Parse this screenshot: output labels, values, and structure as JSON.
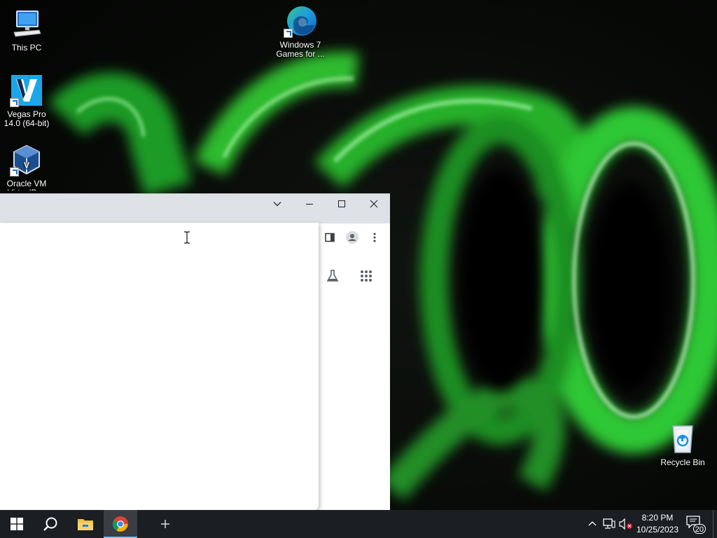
{
  "desktop": {
    "icons": [
      {
        "label": "This PC",
        "icon": "computer-icon"
      },
      {
        "label": "Vegas Pro 14.0 (64-bit)",
        "icon": "vegas-pro-icon"
      },
      {
        "label": "Oracle VM VirtualBox",
        "icon": "virtualbox-icon"
      },
      {
        "label": "Windows 7 Games for ...",
        "icon": "edge-icon"
      },
      {
        "label": "Recycle Bin",
        "icon": "recycle-bin-icon"
      }
    ]
  },
  "browser": {
    "title_buttons": {
      "tab_search": "chevron-down-icon",
      "minimize": "minimize-icon",
      "maximize": "maximize-icon",
      "close": "close-icon"
    },
    "toolbar": [
      "side-panel-icon",
      "profile-icon",
      "more-menu-icon"
    ],
    "content_icons": [
      "labs-flask-icon",
      "apps-grid-icon"
    ]
  },
  "taskbar": {
    "apps": [
      "windows-start-icon",
      "search-icon",
      "file-explorer-icon",
      "chrome-icon"
    ],
    "clock": {
      "time": "8:20 PM",
      "date": "10/25/2023"
    },
    "notification_count": "20"
  },
  "colors": {
    "taskbar": "#1b1e22",
    "titlebar": "#dee1e6",
    "accent": "#76b9ed",
    "wallpaper_green": "#39d13a"
  }
}
